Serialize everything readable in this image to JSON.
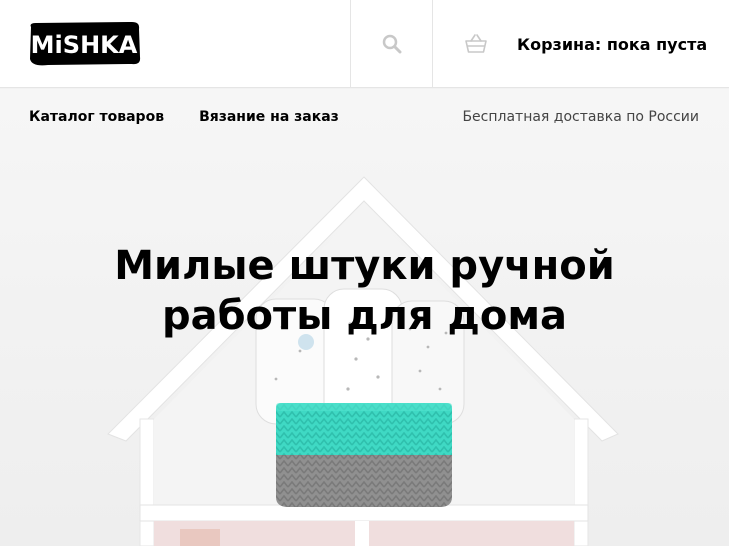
{
  "brand": {
    "logo_text": "MiSHKA"
  },
  "header": {
    "cart_label": "Корзина: пока пуста"
  },
  "nav": {
    "items": [
      {
        "label": "Каталог товаров"
      },
      {
        "label": "Вязание на заказ"
      }
    ],
    "delivery": "Бесплатная доставка по России"
  },
  "hero": {
    "title_line1": "Милые штуки ручной",
    "title_line2": "работы для дома"
  },
  "colors": {
    "accent_mint": "#3fd9c4",
    "knit_gray": "#8f8f8f"
  }
}
